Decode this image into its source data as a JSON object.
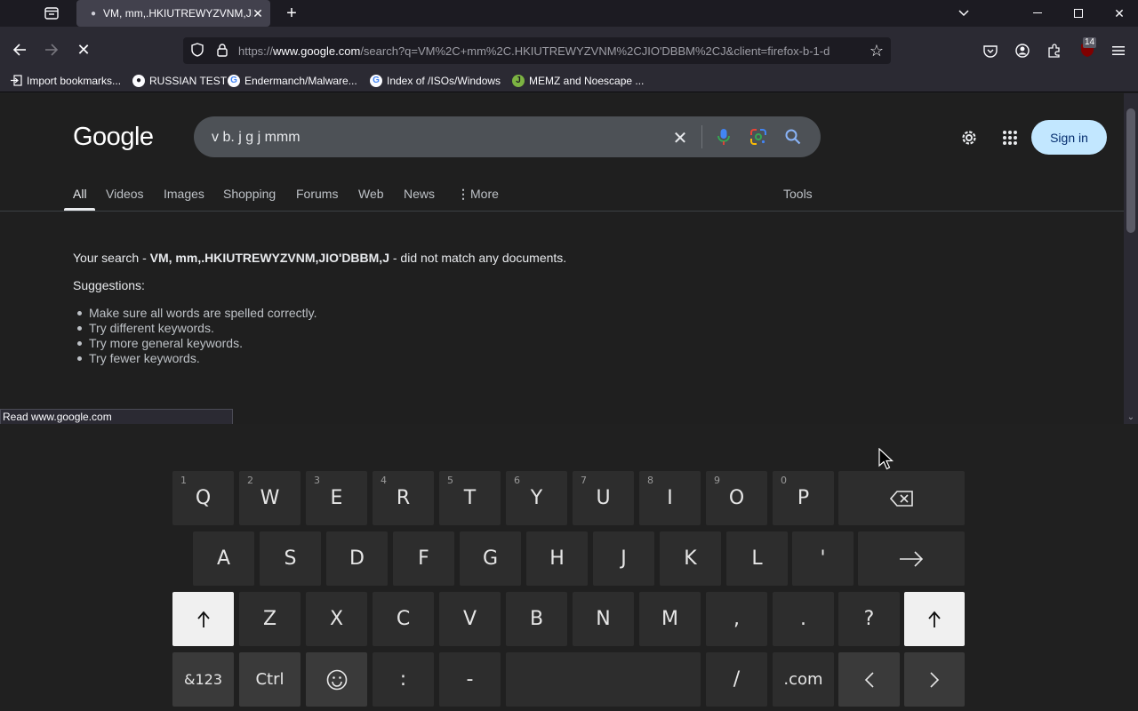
{
  "browser": {
    "tab_title": "VM, mm,.HKIUTREWYZVNM,JIO'DBBM,J",
    "url_prefix": "https://",
    "url_host": "www.google.com",
    "url_path": "/search?q=VM%2C+mm%2C.HKIUTREWYZVNM%2CJIO'DBBM%2CJ&client=firefox-b-1-d",
    "extension_badge": "14",
    "bookmarks": [
      {
        "label": "Import bookmarks..."
      },
      {
        "label": "RUSSIAN TEST"
      },
      {
        "label": "Endermanch/Malware..."
      },
      {
        "label": "Index of /ISOs/Windows"
      },
      {
        "label": "MEMZ and Noescape ..."
      }
    ],
    "status_text": "Read www.google.com"
  },
  "google": {
    "logo": "Google",
    "query": "v b. j g j mmm",
    "sign_in": "Sign in",
    "tabs": [
      "All",
      "Videos",
      "Images",
      "Shopping",
      "Forums",
      "Web",
      "News",
      "More"
    ],
    "tools": "Tools",
    "result_prefix": "Your search - ",
    "result_query": "VM, mm,.HKIUTREWYZVNM,JIO'DBBM,J",
    "result_suffix": " - did not match any documents.",
    "suggestions_title": "Suggestions:",
    "suggestions": [
      "Make sure all words are spelled correctly.",
      "Try different keywords.",
      "Try more general keywords.",
      "Try fewer keywords."
    ]
  },
  "keyboard": {
    "row1": [
      {
        "k": "Q",
        "n": "1"
      },
      {
        "k": "W",
        "n": "2"
      },
      {
        "k": "E",
        "n": "3"
      },
      {
        "k": "R",
        "n": "4"
      },
      {
        "k": "T",
        "n": "5"
      },
      {
        "k": "Y",
        "n": "6"
      },
      {
        "k": "U",
        "n": "7"
      },
      {
        "k": "I",
        "n": "8"
      },
      {
        "k": "O",
        "n": "9"
      },
      {
        "k": "P",
        "n": "0"
      }
    ],
    "row2": [
      "A",
      "S",
      "D",
      "F",
      "G",
      "H",
      "J",
      "K",
      "L",
      "'"
    ],
    "row3": [
      "Z",
      "X",
      "C",
      "V",
      "B",
      "N",
      "M",
      ",",
      ".",
      "?"
    ],
    "sym_key": "&123",
    "ctrl_key": "Ctrl",
    "colon_key": ":",
    "dash_key": "-",
    "slash_key": "/",
    "com_key": ".com"
  },
  "colors": {
    "signin_bg": "#c2e7ff",
    "page_bg": "#1f1f1f"
  }
}
